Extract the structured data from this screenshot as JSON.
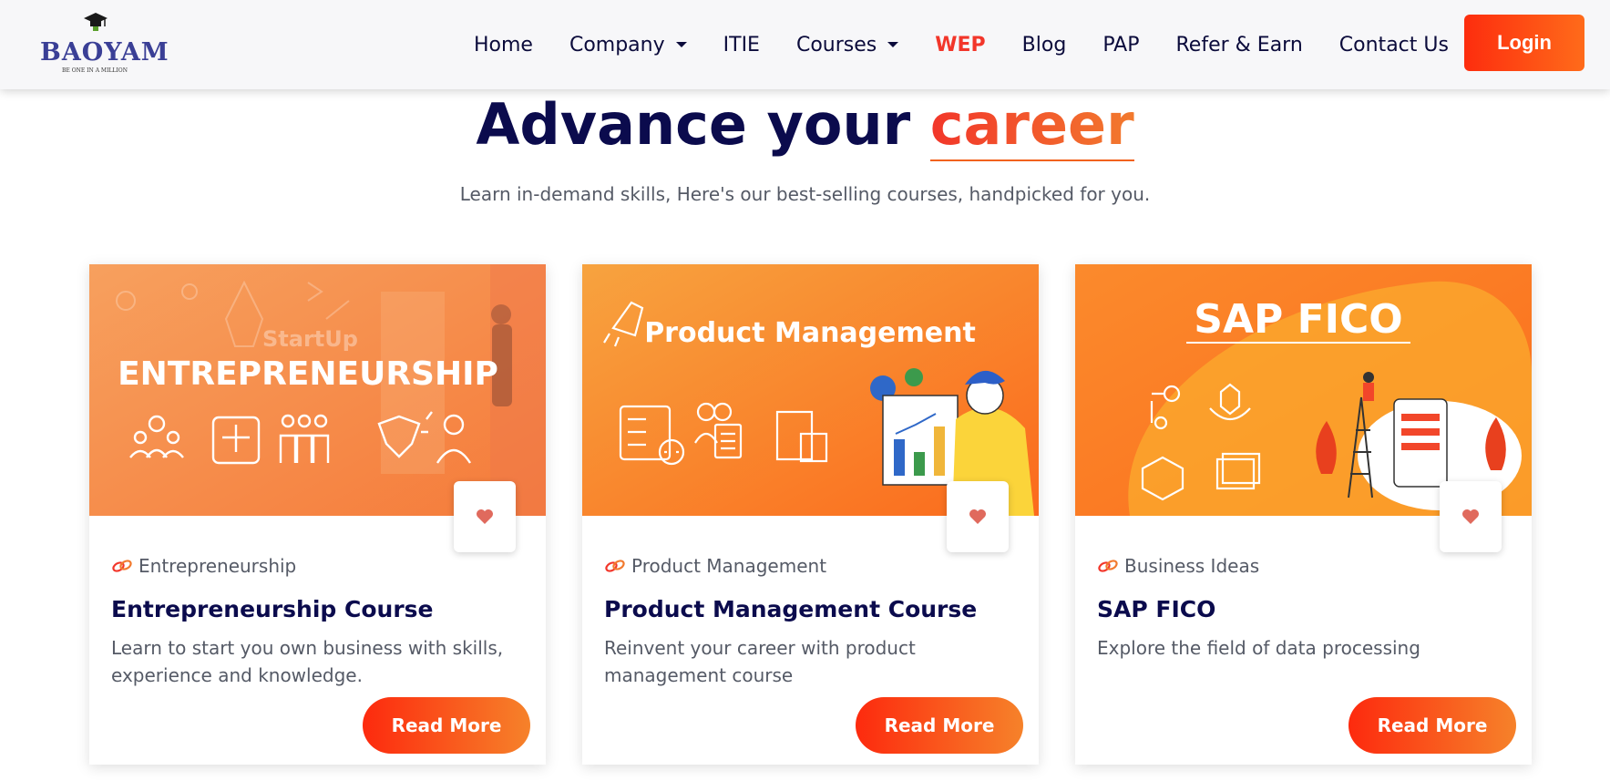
{
  "header": {
    "logo": {
      "name": "BAOYAM",
      "tagline": "BE ONE IN A MILLION"
    },
    "nav": [
      {
        "label": "Home",
        "dropdown": false,
        "active": false
      },
      {
        "label": "Company",
        "dropdown": true,
        "active": false
      },
      {
        "label": "ITIE",
        "dropdown": false,
        "active": false
      },
      {
        "label": "Courses",
        "dropdown": true,
        "active": false
      },
      {
        "label": "WEP",
        "dropdown": false,
        "active": true
      },
      {
        "label": "Blog",
        "dropdown": false,
        "active": false
      },
      {
        "label": "PAP",
        "dropdown": false,
        "active": false
      },
      {
        "label": "Refer & Earn",
        "dropdown": false,
        "active": false
      },
      {
        "label": "Contact Us",
        "dropdown": false,
        "active": false
      }
    ],
    "login_label": "Login"
  },
  "hero": {
    "title_main": "Advance your ",
    "title_accent": "career",
    "subtitle": "Learn in-demand skills, Here's our best-selling courses, handpicked for you."
  },
  "cards": [
    {
      "image_heading": "ENTREPRENEURSHIP",
      "image_subheading": "StartUp",
      "category": "Entrepreneurship",
      "title": "Entrepreneurship Course",
      "description": "Learn to start you own business with skills, experience and knowledge.",
      "button_label": "Read More"
    },
    {
      "image_heading": "Product Management",
      "category": "Product Management",
      "title": "Product Management Course",
      "description": "Reinvent your career with product management course",
      "button_label": "Read More"
    },
    {
      "image_heading": "SAP FICO",
      "category": "Business Ideas",
      "title": "SAP FICO",
      "description": "Explore the field of data processing",
      "button_label": "Read More"
    }
  ],
  "colors": {
    "brand_orange": "#ff6b1a",
    "brand_red": "#f2362a",
    "heading_navy": "#0b0b4d",
    "heart": "#e06a5d"
  },
  "icons": [
    "graduation-cap-icon",
    "chevron-down-icon",
    "link-icon",
    "heart-icon"
  ]
}
